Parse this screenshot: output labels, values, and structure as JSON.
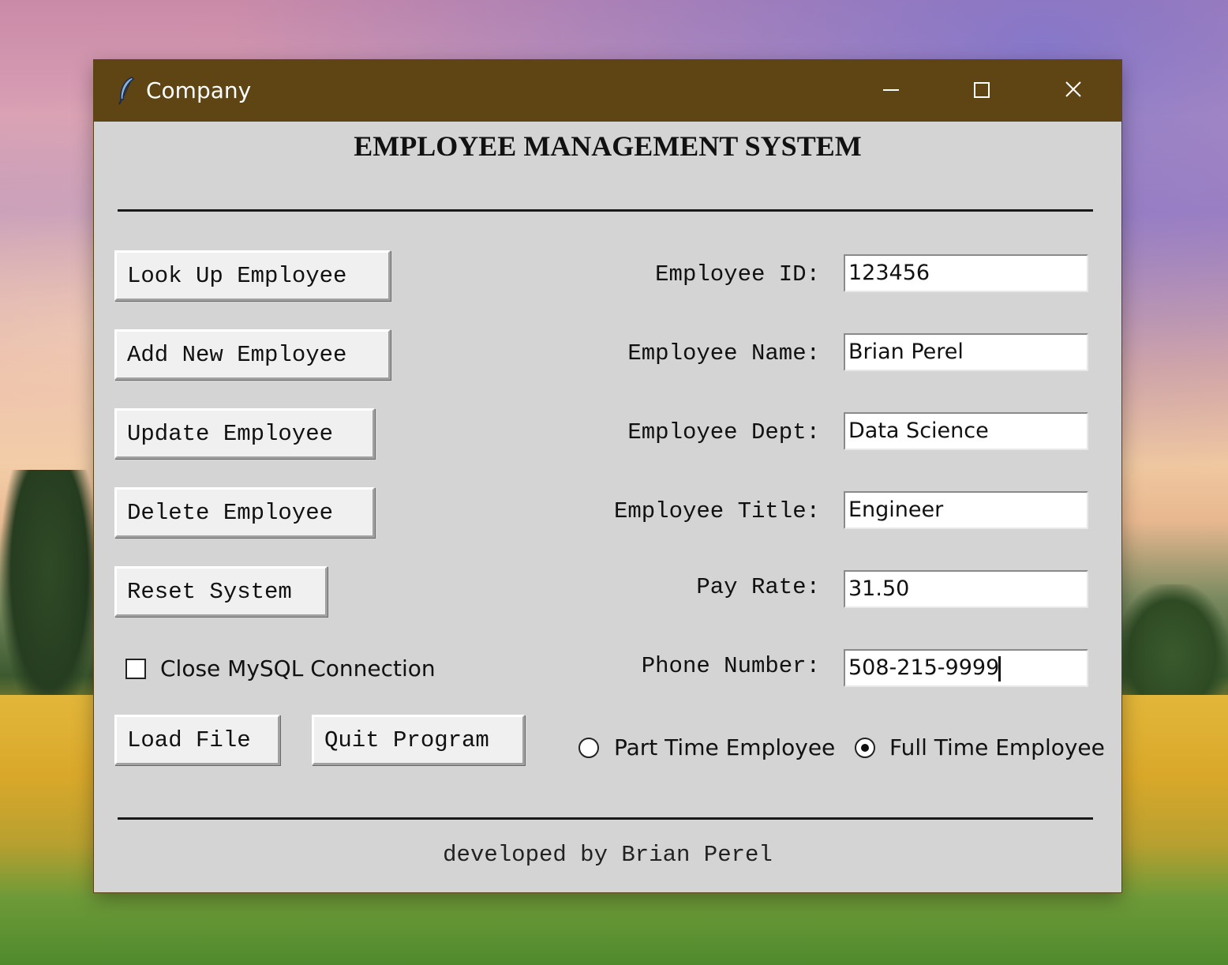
{
  "window": {
    "title": "Company",
    "controls": {
      "minimize_icon": "minimize-icon",
      "maximize_icon": "maximize-icon",
      "close_icon": "close-icon"
    },
    "titlebar_color": "#5f4514"
  },
  "heading": "EMPLOYEE MANAGEMENT SYSTEM",
  "actions": {
    "look_up": "Look Up Employee",
    "add_new": "Add New Employee",
    "update": "Update Employee",
    "delete": "Delete Employee",
    "reset": "Reset System",
    "load_file": "Load File",
    "quit": "Quit Program"
  },
  "close_mysql": {
    "label": "Close MySQL Connection",
    "checked": false
  },
  "fields": {
    "employee_id": {
      "label": "Employee ID:",
      "value": "123456"
    },
    "employee_name": {
      "label": "Employee Name:",
      "value": "Brian Perel"
    },
    "employee_dept": {
      "label": "Employee Dept:",
      "value": "Data Science"
    },
    "employee_title": {
      "label": "Employee Title:",
      "value": "Engineer"
    },
    "pay_rate": {
      "label": "Pay Rate:",
      "value": "31.50"
    },
    "phone_number": {
      "label": "Phone Number:",
      "value": "508-215-9999"
    }
  },
  "employment_type": {
    "part_time": "Part Time Employee",
    "full_time": "Full Time Employee",
    "selected": "Full Time Employee"
  },
  "footer": "developed by Brian Perel"
}
